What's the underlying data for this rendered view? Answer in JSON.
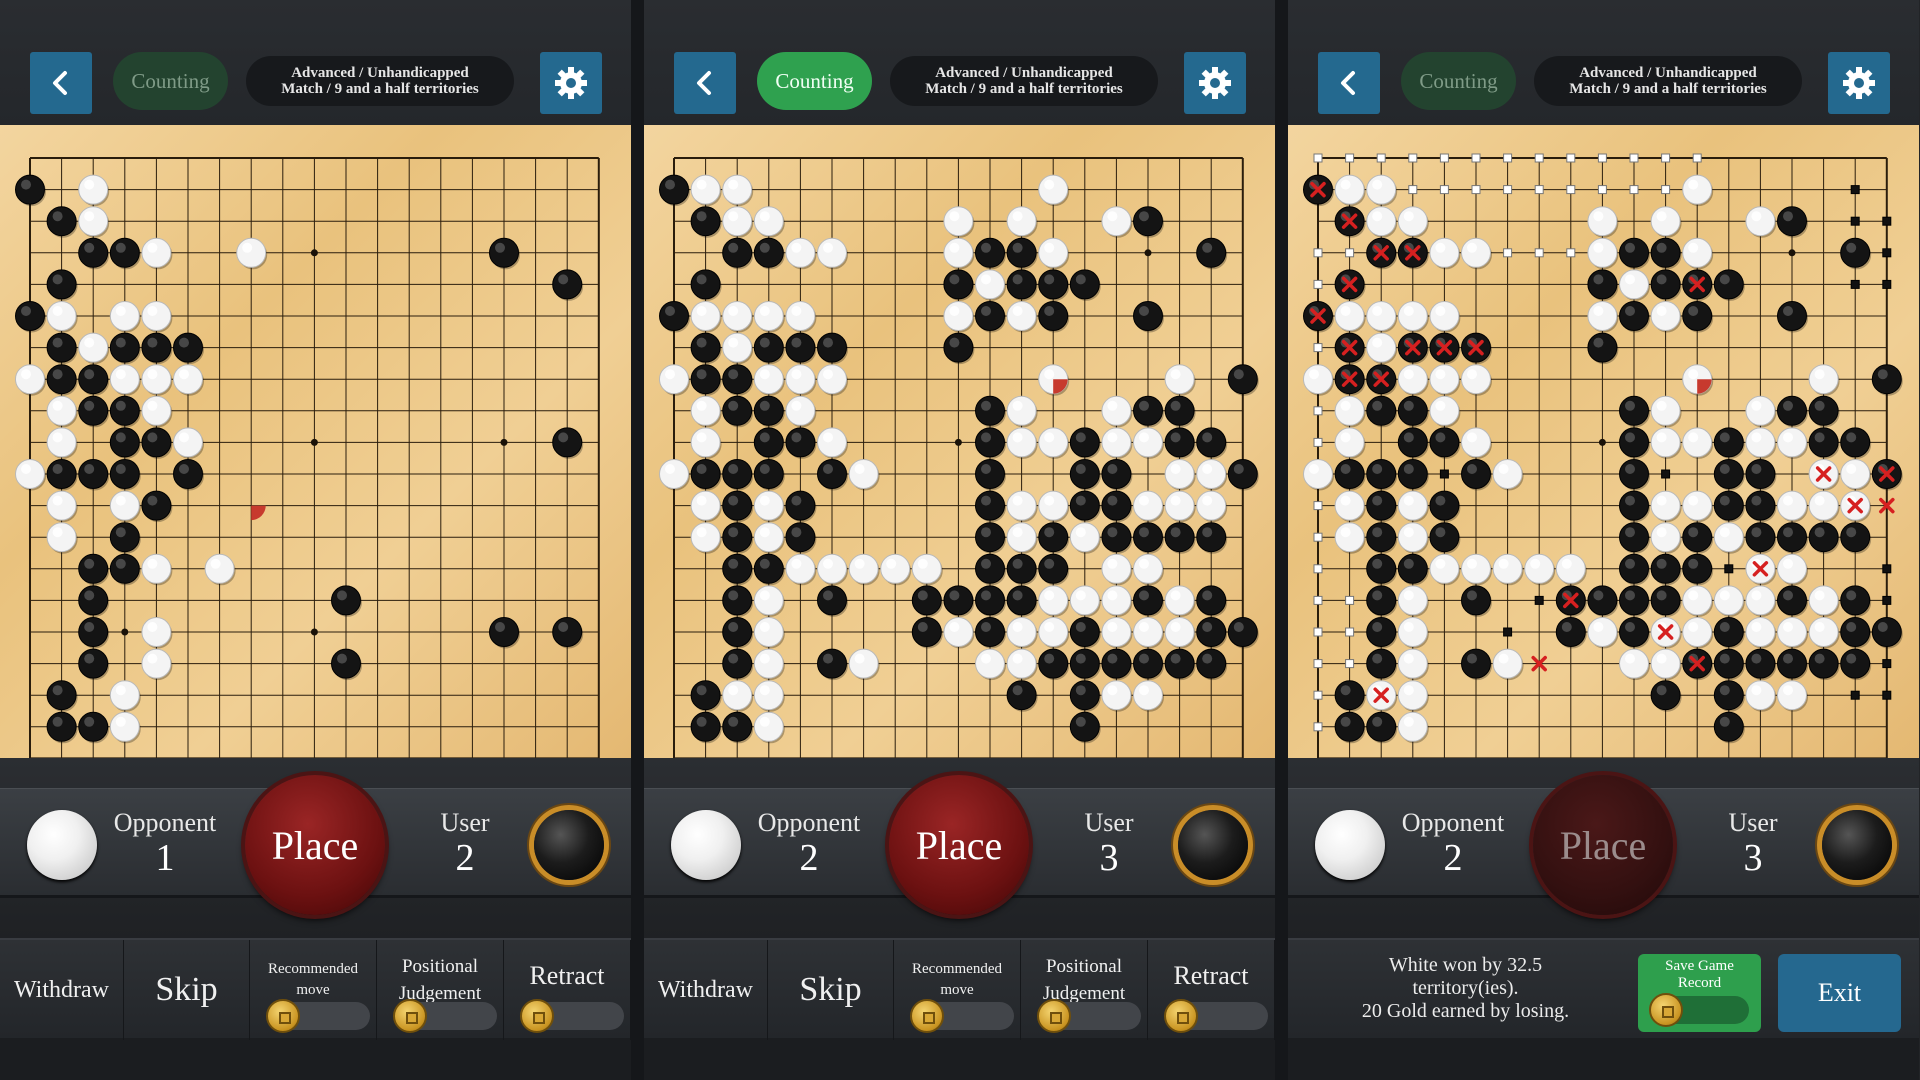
{
  "header": {
    "counting": "Counting",
    "mode_line1": "Advanced / Unhandicapped",
    "mode_line2": "Match / 9 and a half territories",
    "icons": {
      "back": "back-arrow-icon",
      "settings": "gear-icon"
    }
  },
  "players": {
    "opponent_label": "Opponent",
    "user_label": "User",
    "place_label": "Place"
  },
  "actions": {
    "withdraw": "Withdraw",
    "skip": "Skip",
    "recommended_l1": "Recommended",
    "recommended_l2": "move",
    "positional_l1": "Positional",
    "positional_l2": "Judgement",
    "retract": "Retract"
  },
  "result": {
    "line1": "White won by 32.5",
    "line2": "territory(ies).",
    "line3": "20 Gold earned by losing.",
    "save_l1": "Save Game",
    "save_l2": "Record",
    "exit": "Exit"
  },
  "colors": {
    "counting_active": "#2fa14f",
    "counting_dim": "#23432f",
    "button_blue": "#25688f",
    "board": "#eec88a",
    "place_red": "#7a1515"
  },
  "panels": [
    {
      "counting_active": false,
      "opponent_captures": "1",
      "user_captures": "2",
      "place_active": true,
      "show_result": false,
      "board": [
        "B.W..................",
        ".BW..................",
        "..BBW..W.......B.....",
        ".B...............B...",
        "BW.WW................",
        ".BWBBB...............",
        "WBBWWW...............",
        ".WBBW................",
        ".W.BBW...........B...",
        "WBBB.B...............",
        ".W.WB................",
        ".W.B.................",
        "..BBW.W..............",
        "..B.......B..........",
        "..B.W..........B.B...",
        "..B.W.....B..........",
        ".B.W.................",
        ".BBW.................",
        "....................."
      ],
      "last_move": "7,10",
      "marks_x": [],
      "territory": []
    },
    {
      "counting_active": true,
      "opponent_captures": "2",
      "user_captures": "3",
      "place_active": true,
      "show_result": false,
      "board": [
        "BWW.........W........",
        ".BWW.....W.W..WB.....",
        "..BBWW...WBBW....B...",
        ".B.......BWBBB.......",
        "BWWWW....WBWB..B.....",
        ".BWBBB...B...........",
        "WBBWWW......W...W.B..",
        ".WBBW.....BW..WBB....",
        ".W.BBW....BWWBWWBB...",
        "WBBB.BW...B..BB.WWBB.",
        ".WBWB.....BWWBBWWW...",
        ".WBWB.....BWBWBBBB...",
        "..BBWWWWW.BBB.WW.....",
        "..BW.B..BBBBWWWBWB...",
        "..BW....BWBWWBWWWBB..",
        "..BW.BW...WWBBBBBB...",
        ".BWW.......B.BWW.....",
        ".BBW.........B.......",
        "....................."
      ],
      "last_move": "12,6",
      "marks_x": [],
      "territory": []
    },
    {
      "counting_active": false,
      "opponent_captures": "2",
      "user_captures": "3",
      "place_active": false,
      "show_result": true,
      "board": [
        "BWW.........W........",
        ".BWW.....W.W..WB.....",
        "..BBWW...WBBW....B...",
        ".B.......BWBBB.......",
        "BWWWW....WBWB..B.....",
        ".BWBBB...B...........",
        "WBBWWW......W...W.B..",
        ".WBBW.....BW..WBB....",
        ".W.BBW....BWWBWWBB...",
        "WBBB.BW...B..BB.WWBB.",
        ".WBWB.....BWWBBWWW...",
        ".WBWB.....BWBWBBBB...",
        "..BBWWWWW.BBB.WW.....",
        "..BW.B..BBBBWWWBWB...",
        "..BW....BWBWWBWWWBB..",
        "..BW.BW...WWBBBBBB...",
        ".BWW.......B.BWW.....",
        ".BBW.........B.......",
        "....................."
      ],
      "last_move": "12,6",
      "marks_x": [
        "0,0",
        "1,1",
        "2,2",
        "3,2",
        "1,3",
        "0,4",
        "1,5",
        "3,5",
        "4,5",
        "5,5",
        "1,6",
        "2,6",
        "12,3",
        "16,9",
        "18,9",
        "17,10",
        "18,10",
        "8,13",
        "11,14",
        "12,15",
        "7,15",
        "2,16",
        "14,12"
      ],
      "territory": [
        "0,-1",
        "1,-1",
        "2,-1",
        "3,-1",
        "4,-1",
        "5,-1",
        "6,-1",
        "7,-1",
        "8,-1",
        "9,-1",
        "10,-1",
        "11,-1",
        "12,-1",
        "3,0",
        "4,0",
        "5,0",
        "6,0",
        "7,0",
        "8,0",
        "9,0",
        "10,0",
        "11,0",
        "0,2",
        "1,2",
        "6,2",
        "7,2",
        "8,2",
        "0,3",
        "1,3",
        "0,5",
        "0,6",
        "0,7",
        "0,8",
        "0,9",
        "0,10",
        "0,11",
        "17,0",
        "17,1",
        "18,1",
        "18,2",
        "17,3",
        "18,3",
        "0,12",
        "0,13",
        "1,13",
        "0,14",
        "1,14",
        "0,15",
        "1,15",
        "0,16",
        "0,17",
        "10,14",
        "10,15",
        "13,16",
        "14,16",
        "17,16",
        "18,16",
        "12,11",
        "13,12",
        "18,12",
        "16,13",
        "17,13",
        "18,13",
        "18,14",
        "18,15",
        "13,10",
        "14,10",
        "13,11",
        "4,9",
        "5,8",
        "11,9",
        "6,14",
        "7,13",
        "14,8"
      ]
    }
  ]
}
